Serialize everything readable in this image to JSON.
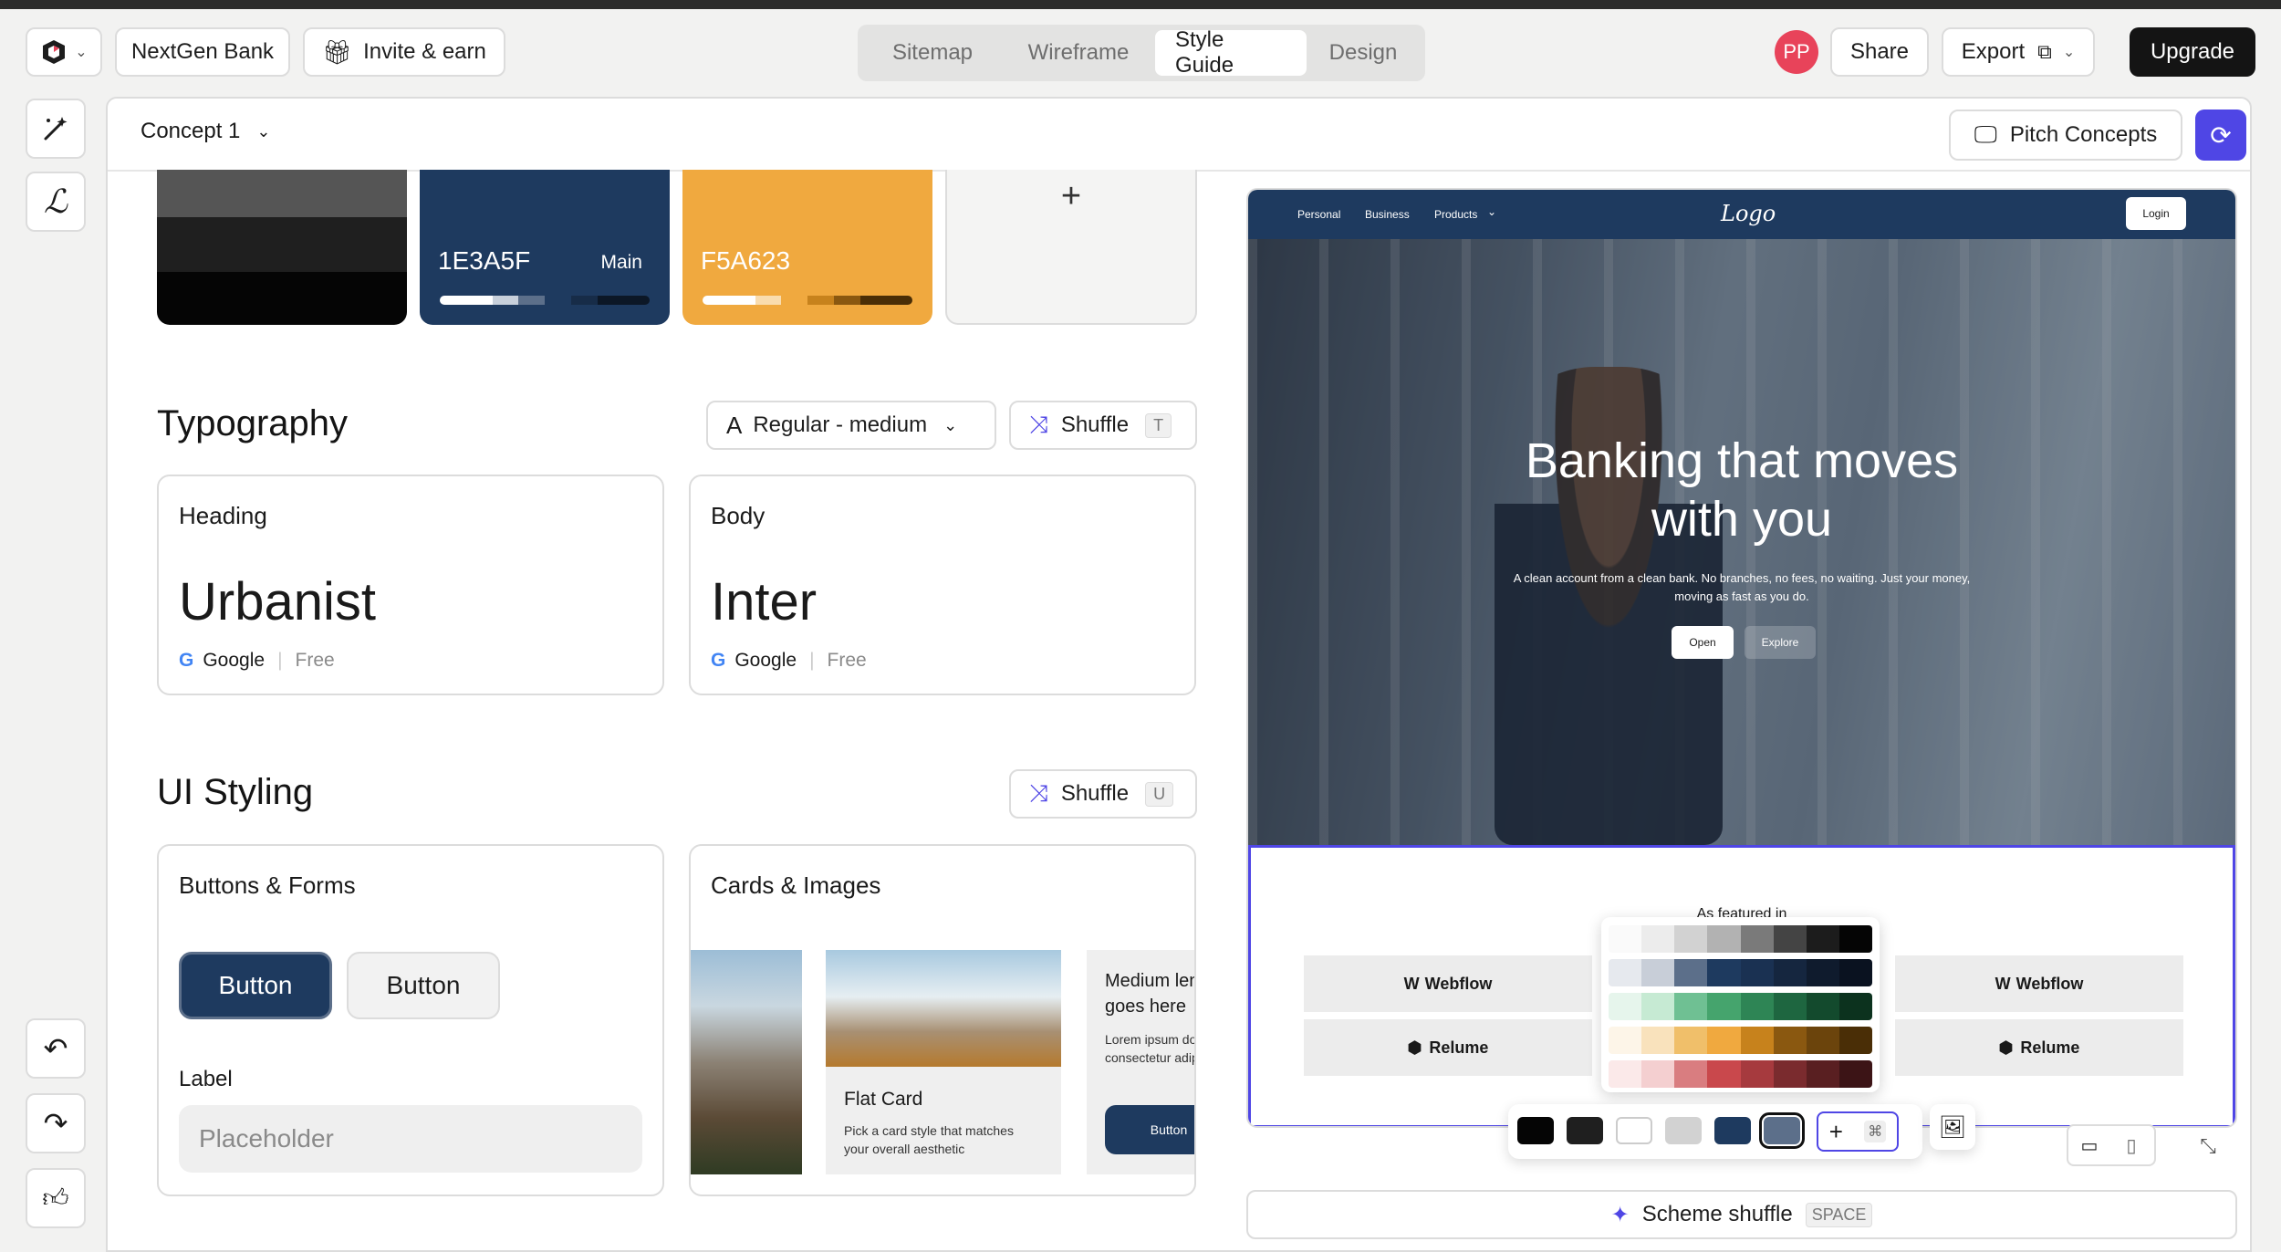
{
  "topbar": {
    "project_name": "NextGen Bank",
    "invite_label": "Invite & earn",
    "tabs": [
      "Sitemap",
      "Wireframe",
      "Style Guide",
      "Design"
    ],
    "active_tab": "Style Guide",
    "avatar_initials": "PP",
    "share_label": "Share",
    "export_label": "Export",
    "upgrade_label": "Upgrade"
  },
  "concept": {
    "selector_label": "Concept 1",
    "pitch_label": "Pitch Concepts"
  },
  "colors": {
    "swatches": [
      {
        "hex": "1E3A5F",
        "tag": "Main",
        "color": "#1e3a5f"
      },
      {
        "hex": "F5A623",
        "tag": "",
        "color": "#f0a93f"
      }
    ],
    "add_label": "+"
  },
  "typography": {
    "title": "Typography",
    "style_select": "Regular - medium",
    "shuffle_label": "Shuffle",
    "shuffle_key": "T",
    "heading": {
      "label": "Heading",
      "font": "Urbanist",
      "source": "Google",
      "price": "Free"
    },
    "body": {
      "label": "Body",
      "font": "Inter",
      "source": "Google",
      "price": "Free"
    }
  },
  "ui_styling": {
    "title": "UI Styling",
    "shuffle_label": "Shuffle",
    "shuffle_key": "U",
    "buttons_forms": {
      "title": "Buttons & Forms",
      "primary_button": "Button",
      "secondary_button": "Button",
      "field_label": "Label",
      "field_placeholder": "Placeholder"
    },
    "cards_images": {
      "title": "Cards & Images",
      "flat_card_title": "Flat Card",
      "flat_card_text": "Pick a card style that matches your overall aesthetic",
      "medium_heading": "Medium length heading goes here",
      "lorem": "Lorem ipsum dolor sit amet, consectetur adipiscing elit",
      "card_button": "Button"
    }
  },
  "preview": {
    "nav_items": [
      "Personal",
      "Business",
      "Products"
    ],
    "logo": "Logo",
    "login_label": "Login",
    "hero_title_line1": "Banking that moves",
    "hero_title_line2": "with you",
    "hero_subtitle_line1": "A clean account from a clean bank. No branches, no fees, no waiting. Just your money,",
    "hero_subtitle_line2": "moving as fast as you do.",
    "hero_primary": "Open",
    "hero_secondary": "Explore",
    "featured_label": "As featured in",
    "logos": [
      "Webflow",
      "Relume",
      "Webflow",
      "Relume"
    ]
  },
  "scheme": {
    "shuffle_label": "Scheme shuffle",
    "shuffle_key": "SPACE"
  },
  "accent_color": "#4f46e5"
}
